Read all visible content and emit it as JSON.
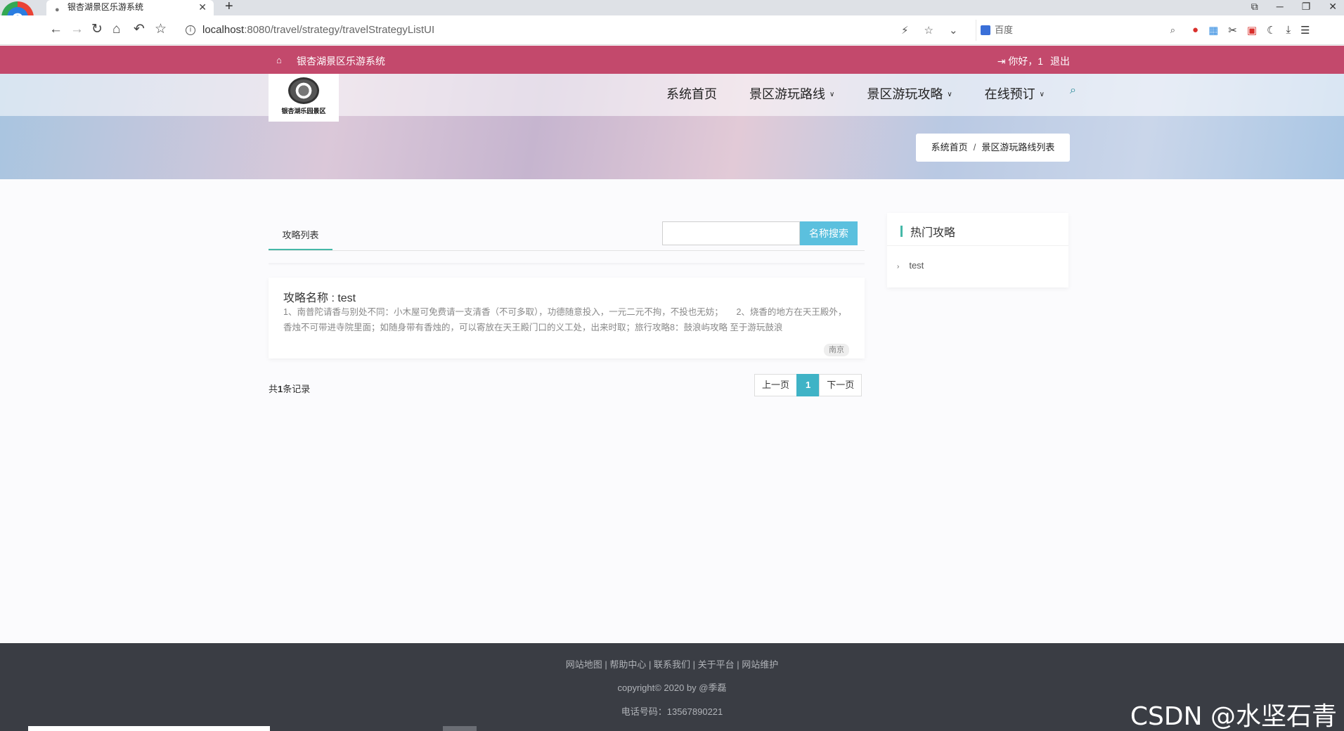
{
  "browser": {
    "tab_title": "银杏湖景区乐游系统",
    "url_host": "localhost",
    "url_rest": ":8080/travel/strategy/travelStrategyListUI",
    "search_engine_label": "百度"
  },
  "topbar": {
    "site_name": "银杏湖景区乐游系统",
    "user_greeting": "你好，1",
    "logout_label": "退出"
  },
  "logo": {
    "text": "银杏湖乐园景区"
  },
  "nav": {
    "items": [
      {
        "label": "系统首页"
      },
      {
        "label": "景区游玩路线"
      },
      {
        "label": "景区游玩攻略"
      },
      {
        "label": "在线预订"
      }
    ]
  },
  "breadcrumb": {
    "home": "系统首页",
    "current": "景区游玩路线列表"
  },
  "list": {
    "tab_label": "攻略列表",
    "search_button": "名称搜索",
    "search_value": "",
    "items": [
      {
        "title": "攻略名称 : test",
        "body": "1、南普陀请香与别处不同：小木屋可免费请一支清香（不可多取），功德随意投入，一元二元不拘，不投也无妨；　　2、烧香的地方在天王殿外，香烛不可带进寺院里面；如随身带有香烛的，可以寄放在天王殿门口的义工处，出来时取；旅行攻略8：鼓浪屿攻略 至于游玩鼓浪",
        "tag": "南京"
      }
    ],
    "record_prefix": "共",
    "record_count": "1",
    "record_suffix": "条记录",
    "pager": {
      "prev": "上一页",
      "current": "1",
      "next": "下一页"
    }
  },
  "hot": {
    "title": "热门攻略",
    "items": [
      {
        "label": "test"
      }
    ]
  },
  "footer": {
    "links": "网站地图 | 帮助中心 | 联系我们 | 关于平台 | 网站维护",
    "copyright": "copyright© 2020 by @季磊",
    "phone": "电话号码：13567890221"
  },
  "watermark": "CSDN @水坚石青"
}
